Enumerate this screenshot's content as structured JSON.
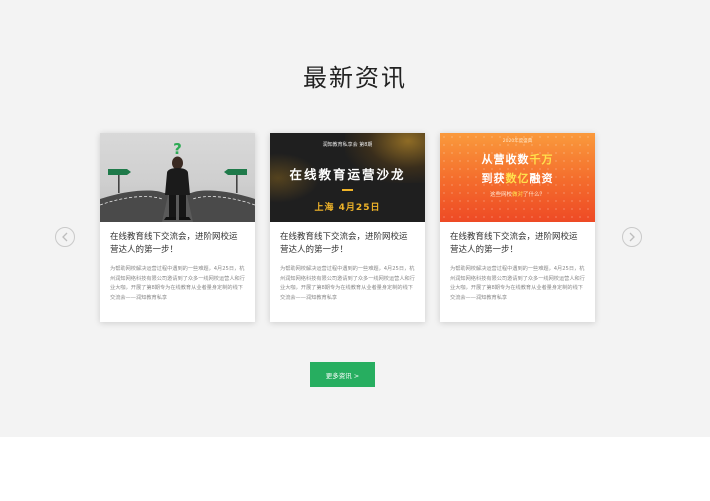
{
  "section": {
    "title": "最新资讯"
  },
  "carousel": {
    "prev_icon": "chevron-left-icon",
    "next_icon": "chevron-right-icon"
  },
  "cards": [
    {
      "image": {
        "question_mark": "?"
      },
      "title": "在线教育线下交流会，进阶网校运营达人的第一步！",
      "desc": "为帮助网校解决运营过程中遇到的一些难题，4月25日，杭州润知网络科技有限公司邀请到了众多一线网校运营人和行业大咖，开展了第8期专为在线教育从业者量身定制的线下交流会——润知教育私享"
    },
    {
      "image": {
        "top_line": "润知教育私享会 第8期",
        "headline": "在线教育运营沙龙",
        "date": "上海 4月25日"
      },
      "title": "在线教育线下交流会，进阶网校运营达人的第一步！",
      "desc": "为帮助网校解决运营过程中遇到的一些难题，4月25日，杭州润知网络科技有限公司邀请到了众多一线网校运营人和行业大咖，开展了第8期专为在线教育从业者量身定制的线下交流会——润知教育私享"
    },
    {
      "image": {
        "top_line": "2020年度盛典",
        "line1_pre": "从营收数",
        "line1_hl": "千万",
        "line2_pre": "到获",
        "line2_hl": "数亿",
        "line2_post": "融资",
        "line3_pre": "这些网校",
        "line3_hl": "做对",
        "line3_post": "了什么？"
      },
      "title": "在线教育线下交流会，进阶网校运营达人的第一步！",
      "desc": "为帮助网校解决运营过程中遇到的一些难题，4月25日，杭州润知网络科技有限公司邀请到了众多一线网校运营人和行业大咖，开展了第8期专为在线教育从业者量身定制的线下交流会——润知教育私享"
    }
  ],
  "more_button": {
    "label": "更多资讯 >"
  },
  "colors": {
    "accent": "#27ae60",
    "section_bg": "#f3f3f3",
    "gold": "#f0b429",
    "orange": "#f46b2c"
  }
}
